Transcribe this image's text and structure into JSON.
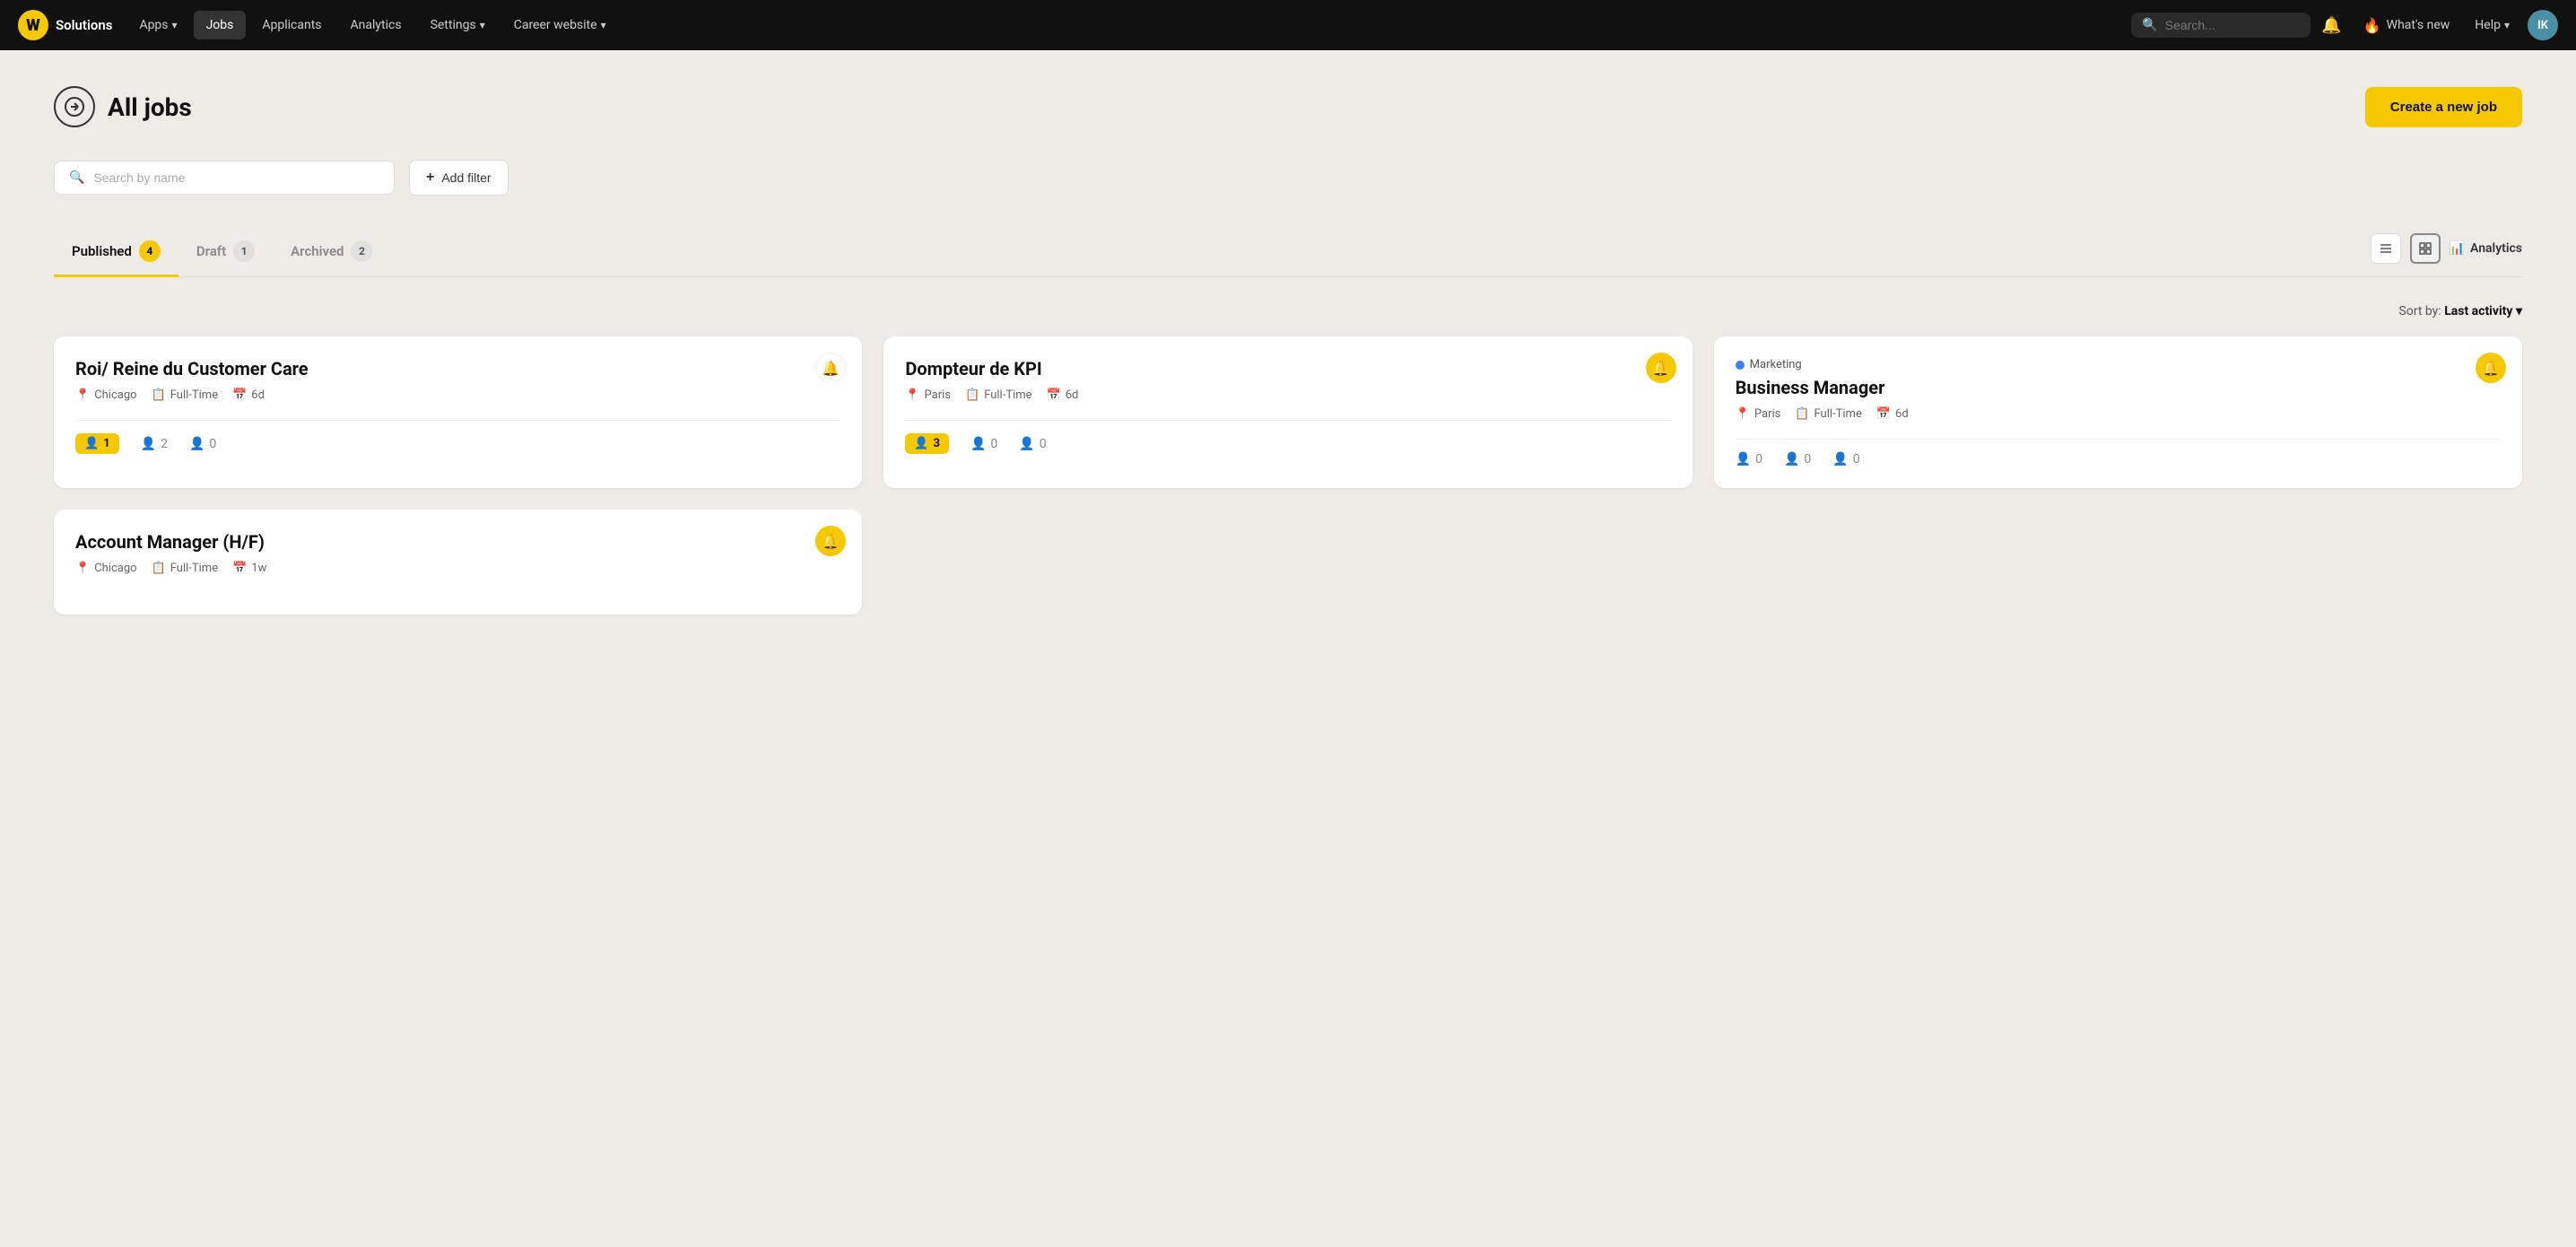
{
  "brand": {
    "logo_letter": "W",
    "name": "Solutions"
  },
  "nav": {
    "items": [
      {
        "id": "apps",
        "label": "Apps",
        "has_dropdown": true
      },
      {
        "id": "jobs",
        "label": "Jobs",
        "active": true,
        "has_dropdown": false
      },
      {
        "id": "applicants",
        "label": "Applicants",
        "has_dropdown": false
      },
      {
        "id": "analytics",
        "label": "Analytics",
        "has_dropdown": false
      },
      {
        "id": "settings",
        "label": "Settings",
        "has_dropdown": true
      },
      {
        "id": "career-website",
        "label": "Career website",
        "has_dropdown": true
      }
    ],
    "search_placeholder": "Search...",
    "whats_new_label": "What's new",
    "help_label": "Help",
    "avatar_initials": "IK"
  },
  "page": {
    "title": "All jobs",
    "create_button": "Create a new job"
  },
  "search": {
    "placeholder": "Search by name"
  },
  "add_filter": {
    "label": "Add filter"
  },
  "tabs": [
    {
      "id": "published",
      "label": "Published",
      "count": 4,
      "active": true
    },
    {
      "id": "draft",
      "label": "Draft",
      "count": 1,
      "active": false
    },
    {
      "id": "archived",
      "label": "Archived",
      "count": 2,
      "active": false
    }
  ],
  "sort": {
    "prefix": "Sort by:",
    "value": "Last activity"
  },
  "analytics_btn": "Analytics",
  "jobs": [
    {
      "id": "job1",
      "category": null,
      "title": "Roi/ Reine du Customer Care",
      "location": "Chicago",
      "type": "Full-Time",
      "posted": "6d",
      "bell_active": false,
      "stats": [
        {
          "value": 1,
          "highlighted": true
        },
        {
          "value": 2,
          "highlighted": false
        },
        {
          "value": 0,
          "highlighted": false
        }
      ]
    },
    {
      "id": "job2",
      "category": null,
      "title": "Dompteur de KPI",
      "location": "Paris",
      "type": "Full-Time",
      "posted": "6d",
      "bell_active": true,
      "stats": [
        {
          "value": 3,
          "highlighted": true
        },
        {
          "value": 0,
          "highlighted": false
        },
        {
          "value": 0,
          "highlighted": false
        }
      ]
    },
    {
      "id": "job3",
      "category": "Marketing",
      "title": "Business Manager",
      "location": "Paris",
      "type": "Full-Time",
      "posted": "6d",
      "bell_active": true,
      "stats": [
        {
          "value": 0,
          "highlighted": false
        },
        {
          "value": 0,
          "highlighted": false
        },
        {
          "value": 0,
          "highlighted": false
        }
      ]
    },
    {
      "id": "job4",
      "category": null,
      "title": "Account Manager (H/F)",
      "location": "Chicago",
      "type": "Full-Time",
      "posted": "1w",
      "bell_active": true,
      "stats": []
    }
  ]
}
